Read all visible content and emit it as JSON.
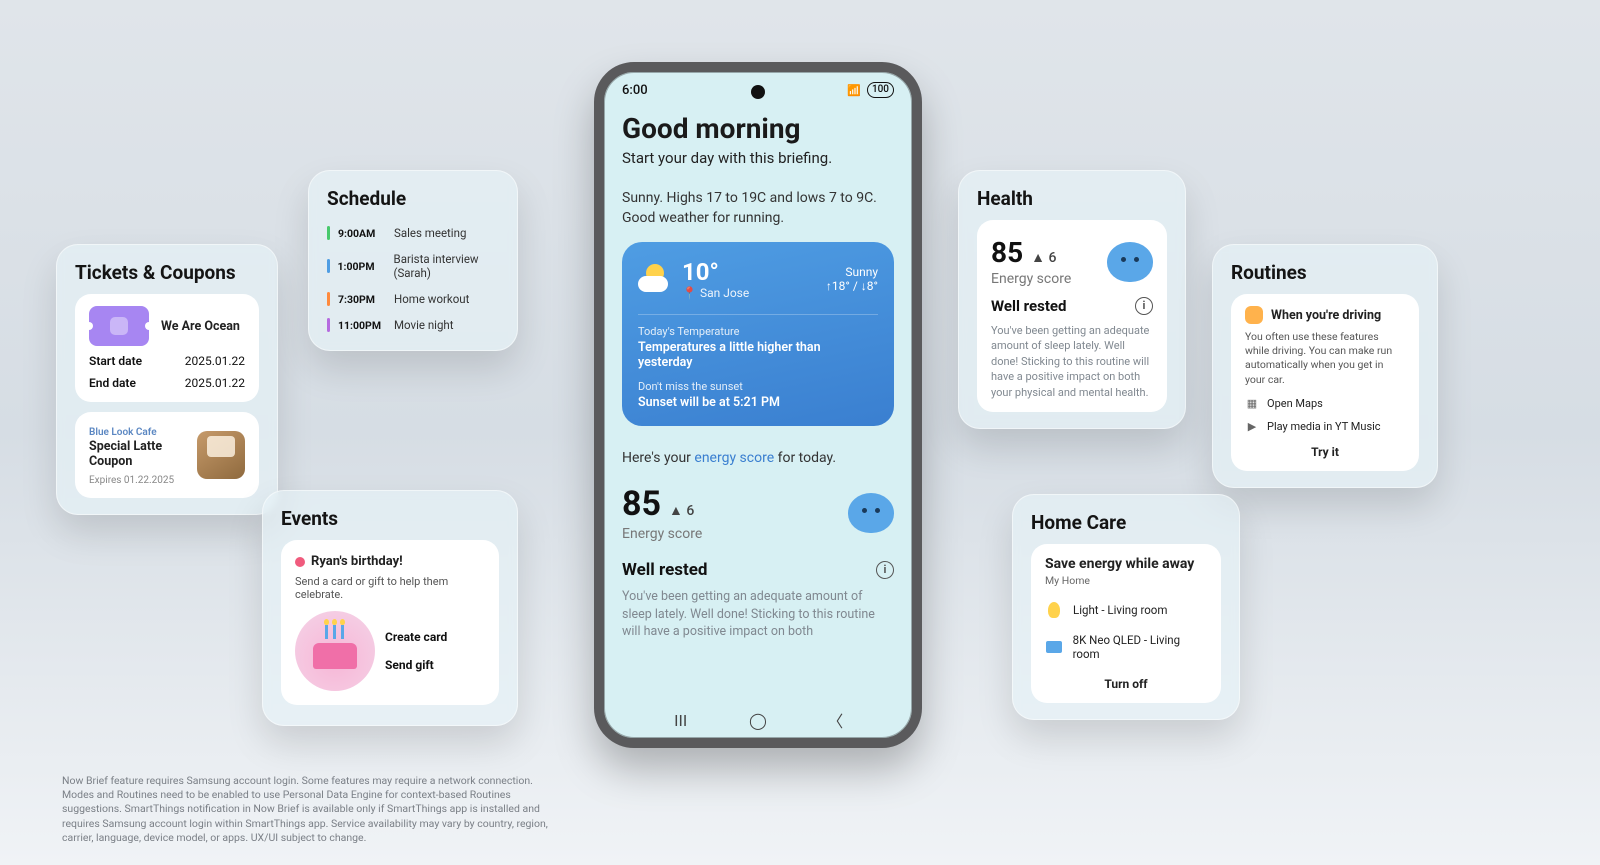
{
  "phone": {
    "time": "6:00",
    "battery": "100",
    "greeting_title": "Good morning",
    "greeting_sub": "Start your day with this briefing.",
    "weather_summary": "Sunny. Highs 17 to 19C and lows 7 to 9C. Good weather for running.",
    "weather": {
      "temp": "10°",
      "location": "San Jose",
      "condition": "Sunny",
      "hi_lo": "↑18° / ↓8°",
      "today_label": "Today's Temperature",
      "today_text": "Temperatures a little higher than yesterday",
      "sunset_label": "Don't miss the sunset",
      "sunset_text": "Sunset will be at 5:21 PM"
    },
    "energy_prefix": "Here's your ",
    "energy_link": "energy score",
    "energy_suffix": " for today.",
    "score": "85",
    "score_delta": "▲ 6",
    "score_label": "Energy score",
    "rested_title": "Well rested",
    "rested_text": "You've been getting an adequate amount of sleep lately. Well done! Sticking to this routine will have a positive impact on both"
  },
  "tickets": {
    "title": "Tickets & Coupons",
    "event_name": "We Are Ocean",
    "start_label": "Start date",
    "start_value": "2025.01.22",
    "end_label": "End date",
    "end_value": "2025.01.22",
    "coupon_brand": "Blue Look Cafe",
    "coupon_name": "Special Latte Coupon",
    "coupon_expires": "Expires 01.22.2025"
  },
  "schedule": {
    "title": "Schedule",
    "items": [
      {
        "color": "#47c96c",
        "time": "9:00AM",
        "title": "Sales meeting"
      },
      {
        "color": "#4f9de3",
        "time": "1:00PM",
        "title": "Barista interview (Sarah)"
      },
      {
        "color": "#ff8a3d",
        "time": "7:30PM",
        "title": "Home workout"
      },
      {
        "color": "#b56be0",
        "time": "11:00PM",
        "title": "Movie night"
      }
    ]
  },
  "events": {
    "title": "Events",
    "heading": "Ryan's birthday!",
    "sub": "Send a card or gift to help them celebrate.",
    "action1": "Create card",
    "action2": "Send gift"
  },
  "health": {
    "title": "Health",
    "score": "85",
    "score_delta": "▲ 6",
    "score_label": "Energy score",
    "rested_title": "Well rested",
    "rested_text": "You've been getting an adequate amount of sleep lately. Well done! Sticking to this routine will have a positive impact on both your physical and mental health."
  },
  "routines": {
    "title": "Routines",
    "heading": "When you're driving",
    "sub": "You often use these features while driving. You can make run automatically when you get in your car.",
    "item1": "Open Maps",
    "item2": "Play media in YT Music",
    "button": "Try it"
  },
  "homecare": {
    "title": "Home Care",
    "heading": "Save energy while away",
    "sub": "My Home",
    "item1": "Light - Living room",
    "item2": "8K Neo QLED - Living room",
    "button": "Turn off"
  },
  "disclaimer": "Now Brief feature requires Samsung account login. Some features may require a network connection. Modes and Routines need to be enabled to use Personal Data Engine for context-based Routines suggestions. SmartThings notification in Now Brief is available only if SmartThings app is installed and requires Samsung account login within SmartThings app. Service availability may vary by country, region, carrier, language, device model, or apps. UX/UI subject to change."
}
